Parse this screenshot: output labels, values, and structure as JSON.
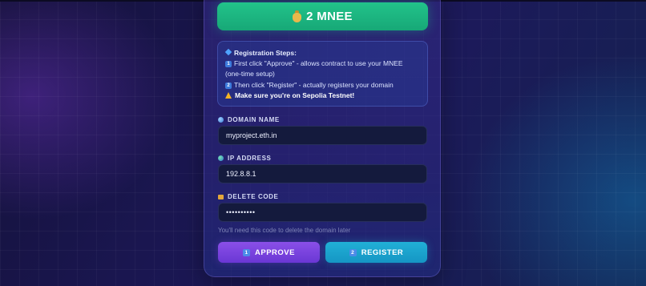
{
  "price": {
    "icon": "money-bag-icon",
    "label": "2 MNEE"
  },
  "steps": {
    "title": "Registration Steps:",
    "step1_key": "1",
    "step1": "First click \"Approve\" - allows contract to use your MNEE (one-time setup)",
    "step2_key": "2",
    "step2": "Then click \"Register\" - actually registers your domain",
    "warning": "Make sure you're on Sepolia Testnet!"
  },
  "fields": {
    "domain": {
      "icon": "globe-icon",
      "label": "DOMAIN NAME",
      "value": "myproject.eth.in"
    },
    "ip": {
      "icon": "earth-icon",
      "label": "IP ADDRESS",
      "value": "192.8.8.1"
    },
    "delete_code": {
      "icon": "lock-icon",
      "label": "DELETE CODE",
      "value": "••••••••••",
      "hint": "You'll need this code to delete the domain later"
    }
  },
  "buttons": {
    "approve_key": "1",
    "approve": "APPROVE",
    "register_key": "2",
    "register": "REGISTER"
  },
  "colors": {
    "accent_green": "#1fb983",
    "approve_purple": "#7a45de",
    "register_cyan": "#1ba6d0",
    "warning_yellow": "#f5b324"
  }
}
